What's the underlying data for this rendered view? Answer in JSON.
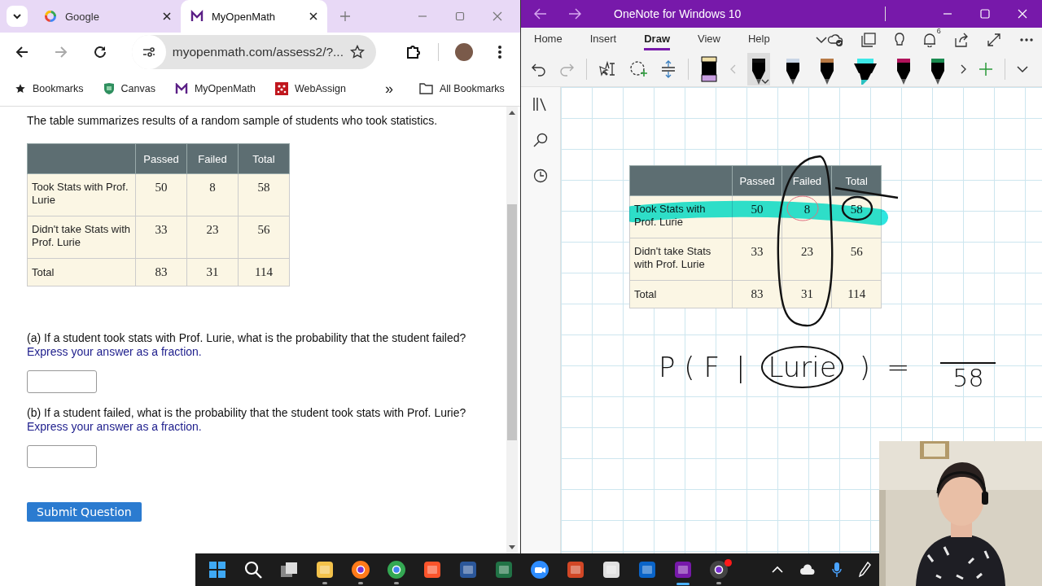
{
  "browser": {
    "tabs": [
      {
        "title": "Google",
        "kind": "google",
        "selected": false
      },
      {
        "title": "MyOpenMath",
        "kind": "mom",
        "selected": true
      }
    ],
    "address": "myopenmath.com/assess2/?...",
    "bookmarks": [
      {
        "label": "Bookmarks",
        "kind": "star"
      },
      {
        "label": "Canvas",
        "kind": "canvas"
      },
      {
        "label": "MyOpenMath",
        "kind": "mom"
      },
      {
        "label": "WebAssign",
        "kind": "webassign"
      }
    ],
    "more_bookmarks": "»",
    "all_bookmarks": "All Bookmarks",
    "page": {
      "intro": "The table summarizes results of a random sample of students who took statistics.",
      "table": {
        "columns": [
          "Passed",
          "Failed",
          "Total"
        ],
        "rows": [
          {
            "label": "Took Stats with Prof. Lurie",
            "cells": [
              "50",
              "8",
              "58"
            ]
          },
          {
            "label": "Didn't take Stats with Prof. Lurie",
            "cells": [
              "33",
              "23",
              "56"
            ]
          },
          {
            "label": "Total",
            "cells": [
              "83",
              "31",
              "114"
            ]
          }
        ]
      },
      "questions": [
        {
          "text": "(a) If a student took stats with Prof. Lurie, what is the probability that the student failed?",
          "hint": "Express your answer as a fraction."
        },
        {
          "text": "(b) If a student failed, what is the probability that the student took stats with Prof. Lurie?",
          "hint": "Express your answer as a fraction."
        }
      ],
      "submit": "Submit Question"
    }
  },
  "onenote": {
    "title": "OneNote for Windows 10",
    "ribbon_tabs": [
      {
        "label": "Home",
        "selected": false
      },
      {
        "label": "Insert",
        "selected": false
      },
      {
        "label": "Draw",
        "selected": true
      },
      {
        "label": "View",
        "selected": false
      },
      {
        "label": "Help",
        "selected": false
      }
    ],
    "notification_count": "6",
    "pens": [
      {
        "kind": "pen",
        "color": "#111111",
        "selected": true
      },
      {
        "kind": "pen",
        "color": "#c9d6e6",
        "selected": false
      },
      {
        "kind": "pen",
        "color": "#b87a45",
        "selected": false
      },
      {
        "kind": "highlighter",
        "color": "#3ee8e8",
        "selected": false
      },
      {
        "kind": "pen",
        "color": "#b0125a",
        "selected": false
      },
      {
        "kind": "pen",
        "color": "#1a8a50",
        "selected": false
      }
    ],
    "table": {
      "columns": [
        "Passed",
        "Failed",
        "Total"
      ],
      "rows": [
        {
          "label": "Took Stats with Prof. Lurie",
          "cells": [
            "50",
            "8",
            "58"
          ]
        },
        {
          "label": "Didn't take Stats with Prof. Lurie",
          "cells": [
            "33",
            "23",
            "56"
          ]
        },
        {
          "label": "Total",
          "cells": [
            "83",
            "31",
            "114"
          ]
        }
      ]
    },
    "handwriting": [
      {
        "kind": "text",
        "text": "P ( F"
      },
      {
        "kind": "text",
        "text": "|"
      },
      {
        "kind": "circled",
        "text": "Lurie"
      },
      {
        "kind": "text",
        "text": ")"
      },
      {
        "kind": "text",
        "text": "="
      },
      {
        "kind": "fraction",
        "denominator": "58"
      }
    ]
  },
  "taskbar": {
    "apps": [
      {
        "kind": "start",
        "running": false,
        "active": false
      },
      {
        "kind": "search",
        "running": false,
        "active": false
      },
      {
        "kind": "taskview",
        "running": false,
        "active": false
      },
      {
        "kind": "files",
        "running": true,
        "active": false
      },
      {
        "kind": "firefox",
        "running": true,
        "active": false
      },
      {
        "kind": "chrome",
        "running": true,
        "active": false
      },
      {
        "kind": "brave",
        "running": false,
        "active": false
      },
      {
        "kind": "word",
        "running": false,
        "active": false
      },
      {
        "kind": "excel",
        "running": false,
        "active": false
      },
      {
        "kind": "zoom",
        "running": false,
        "active": false
      },
      {
        "kind": "powerpoint",
        "running": false,
        "active": false
      },
      {
        "kind": "snip",
        "running": false,
        "active": false
      },
      {
        "kind": "outlook",
        "running": false,
        "active": false
      },
      {
        "kind": "onenote",
        "running": true,
        "active": true
      },
      {
        "kind": "obs",
        "running": true,
        "active": false
      }
    ]
  }
}
